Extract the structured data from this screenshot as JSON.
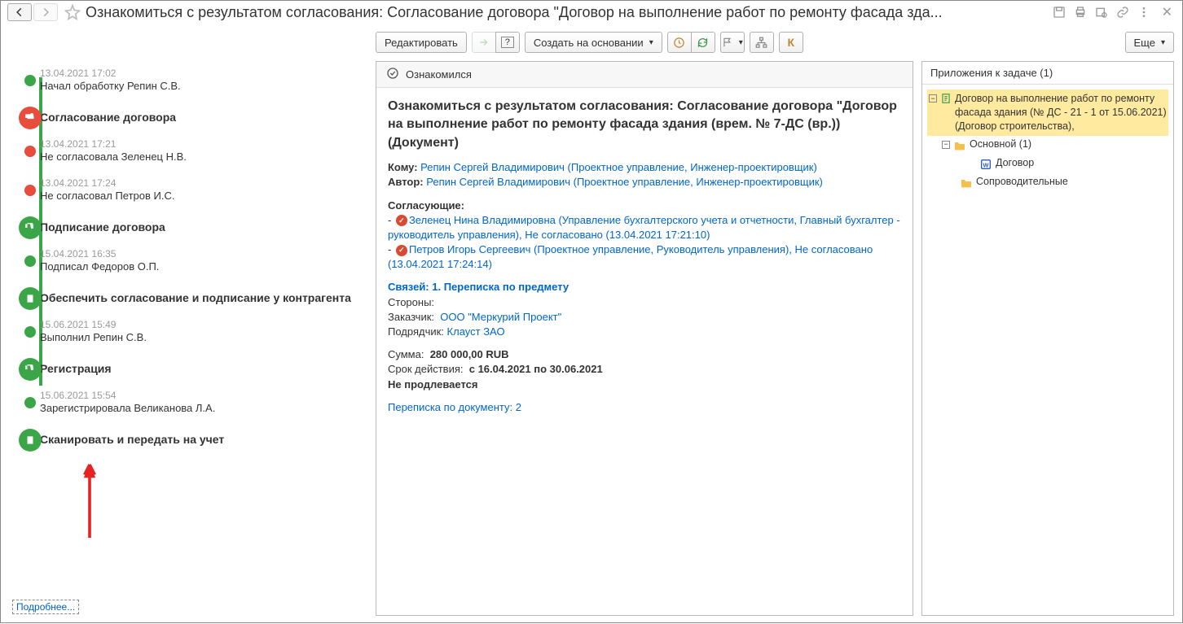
{
  "header": {
    "title": "Ознакомиться с результатом согласования: Согласование договора \"Договор  на  выполнение работ по ремонту фасада зда..."
  },
  "toolbar": {
    "edit": "Редактировать",
    "create_based": "Создать на основании",
    "more": "Еще"
  },
  "timeline": [
    {
      "type": "small-green",
      "date": "13.04.2021 17:02",
      "text": "Начал обработку Репин С.В."
    },
    {
      "type": "big-red-thumb",
      "bold_text": "Согласование договора"
    },
    {
      "type": "small-red",
      "date": "13.04.2021 17:21",
      "text": "Не согласовала Зеленец Н.В."
    },
    {
      "type": "small-red",
      "date": "13.04.2021 17:24",
      "text": "Не согласовал Петров И.С."
    },
    {
      "type": "big-green-thumb",
      "bold_text": "Подписание договора"
    },
    {
      "type": "small-green",
      "date": "15.04.2021 16:35",
      "text": "Подписал Федоров О.П."
    },
    {
      "type": "big-green-doc",
      "bold_text": "Обеспечить согласование и подписание у контрагента"
    },
    {
      "type": "small-green",
      "date": "15.06.2021 15:49",
      "text": "Выполнил Репин С.В."
    },
    {
      "type": "big-green-thumb",
      "bold_text": "Регистрация"
    },
    {
      "type": "small-green",
      "date": "15.06.2021 15:54",
      "text": "Зарегистрировала Великанова Л.А."
    },
    {
      "type": "big-green-doc",
      "bold_text": "Сканировать и передать на учет"
    }
  ],
  "left_footer_link": "Подробнее...",
  "center": {
    "status": "Ознакомился",
    "heading": "Ознакомиться с результатом согласования: Согласование договора \"Договор  на  выполнение работ по ремонту фасада здания (врем. № 7-ДС (вр.)) (Документ)",
    "to_label": "Кому:",
    "to_value": "Репин Сергей Владимирович (Проектное управление, Инженер-проектировщик)",
    "author_label": "Автор:",
    "author_value": "Репин Сергей Владимирович (Проектное управление, Инженер-проектировщик)",
    "approvers_label": "Согласующие:",
    "approver1": "Зеленец Нина Владимировна (Управление бухгалтерского учета и отчетности, Главный бухгалтер - руководитель управления), Не согласовано (13.04.2021 17:21:10)",
    "approver2": "Петров Игорь Сергеевич (Проектное управление, Руководитель управления), Не согласовано (13.04.2021 17:24:14)",
    "links_label": "Связей: 1. Переписка по предмету",
    "sides_label": "Стороны:",
    "customer_label": "Заказчик:",
    "customer_value": "ООО \"Меркурий Проект\"",
    "contractor_label": "Подрядчик:",
    "contractor_value": "Клауст ЗАО",
    "sum_label": "Сумма:",
    "sum_value": "280 000,00 RUB",
    "term_label": "Срок действия:",
    "term_value": "с 16.04.2021 по 30.06.2021",
    "noprolong": "Не продлевается",
    "correspondence_label": "Переписка по документу:",
    "correspondence_count": "2"
  },
  "right": {
    "header": "Приложения к задаче (1)",
    "doc_title": "Договор  на  выполнение работ по ремонту фасада здания (№ ДС - 21 - 1 от 15.06.2021) (Договор строительства),",
    "folder_main": "Основной (1)",
    "file_doc": "Договор",
    "folder_accomp": "Сопроводительные"
  }
}
